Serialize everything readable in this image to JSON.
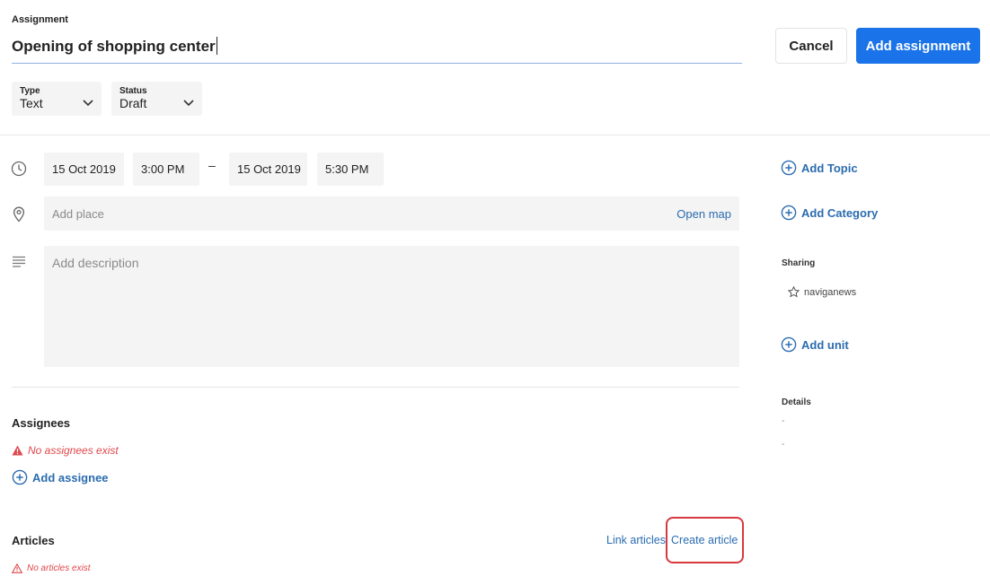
{
  "header": {
    "section_label": "Assignment",
    "title_value": "Opening of shopping center",
    "cancel_label": "Cancel",
    "add_label": "Add assignment"
  },
  "type_dropdown": {
    "label": "Type",
    "value": "Text"
  },
  "status_dropdown": {
    "label": "Status",
    "value": "Draft"
  },
  "schedule": {
    "start_date": "15 Oct 2019",
    "start_time": "3:00 PM",
    "separator": "–",
    "end_date": "15 Oct 2019",
    "end_time": "5:30 PM"
  },
  "place": {
    "placeholder": "Add place",
    "open_map": "Open map"
  },
  "description": {
    "placeholder": "Add description"
  },
  "assignees": {
    "title": "Assignees",
    "empty_text": "No assignees exist",
    "add_label": "Add assignee"
  },
  "articles": {
    "title": "Articles",
    "empty_text": "No articles exist",
    "link_label": "Link articles",
    "create_label": "Create article"
  },
  "sidebar": {
    "add_topic": "Add Topic",
    "add_category": "Add Category",
    "sharing_title": "Sharing",
    "sharing_item": "naviganews",
    "add_unit": "Add unit",
    "details_title": "Details",
    "details_line1": "-",
    "details_line2": "-"
  },
  "colors": {
    "accent": "#1a73e8",
    "link": "#2b6cb0",
    "error": "#e0474c",
    "highlight": "#d6393f"
  },
  "icons": [
    "clock-icon",
    "location-pin-icon",
    "description-lines-icon",
    "plus-circle-icon",
    "star-icon",
    "warning-icon",
    "chevron-down-icon"
  ]
}
